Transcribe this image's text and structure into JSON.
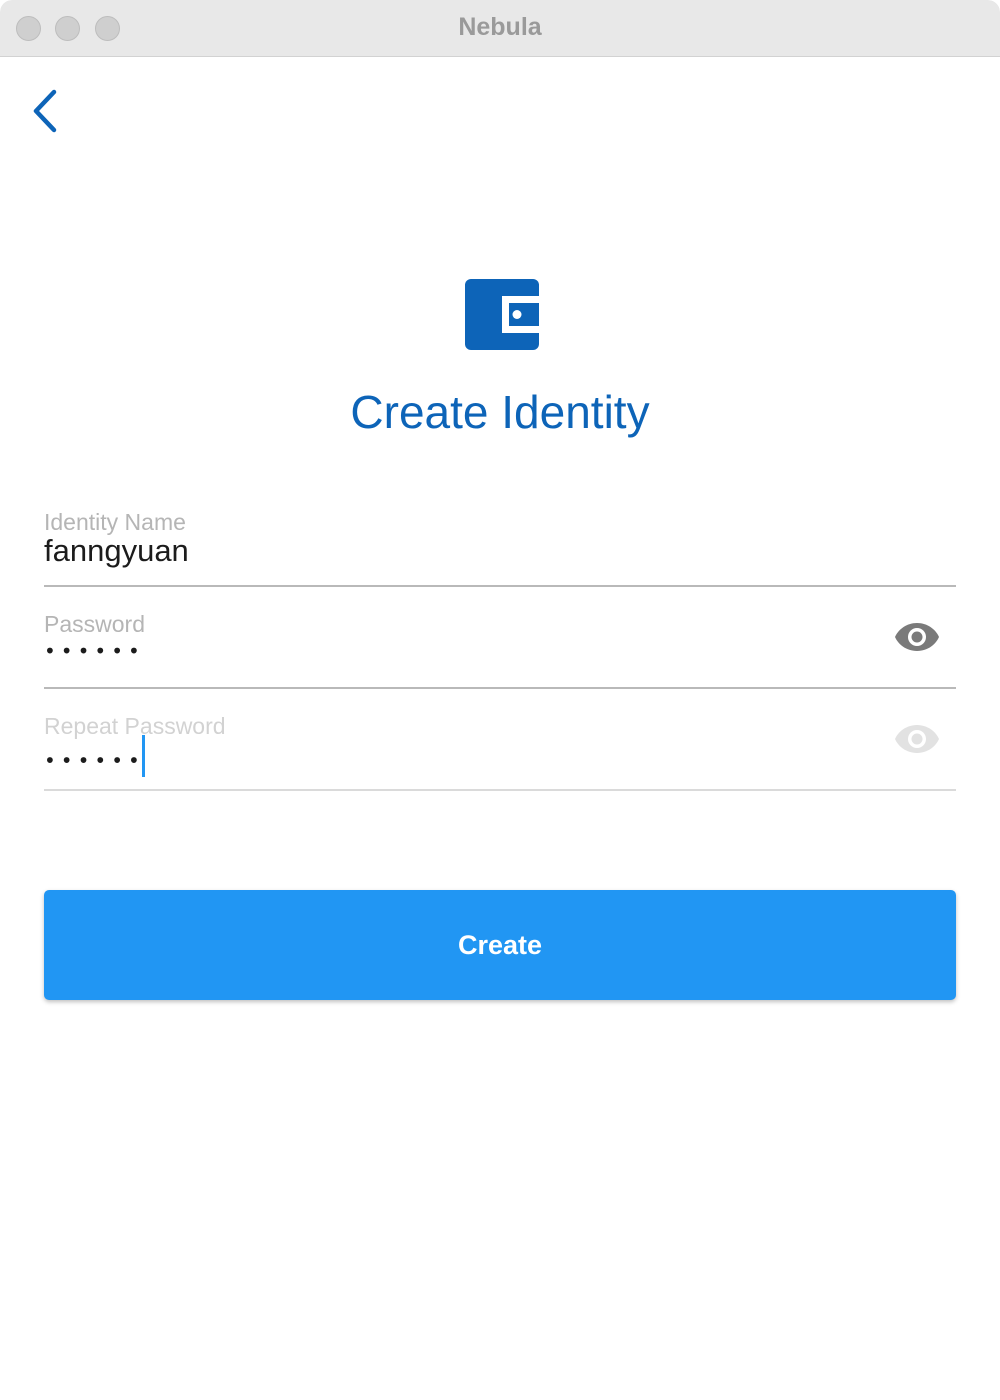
{
  "window": {
    "title": "Nebula"
  },
  "page": {
    "heading": "Create Identity"
  },
  "fields": {
    "identity_name": {
      "label": "Identity Name",
      "value": "fanngyuan"
    },
    "password": {
      "label": "Password",
      "masked_value": "••••••"
    },
    "repeat_password": {
      "label": "Repeat Password",
      "masked_value": "••••••"
    }
  },
  "actions": {
    "create_label": "Create"
  },
  "icons": {
    "back": "chevron-left-icon",
    "logo": "wallet-icon",
    "password_toggle": "eye-icon",
    "repeat_password_toggle": "eye-icon"
  },
  "colors": {
    "accent": "#0d64b8",
    "button": "#2196f3",
    "caret": "#2196f3"
  }
}
